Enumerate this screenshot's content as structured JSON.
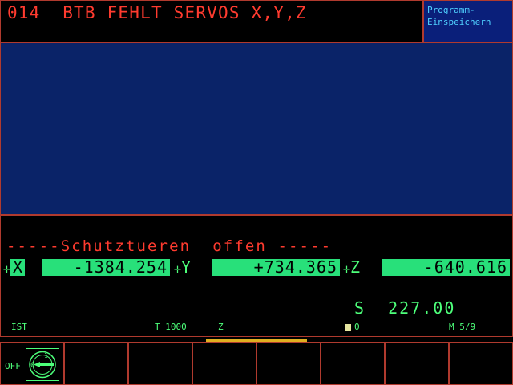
{
  "header": {
    "error_message": "014  BTB FEHLT SERVOS X,Y,Z",
    "mode_label": "Programm-\nEinspeichern"
  },
  "info": {
    "door_message": "-----Schutztueren  offen -----"
  },
  "axes": [
    {
      "letter": "X",
      "value": "-1384.254"
    },
    {
      "letter": "Y",
      "value": "+734.365"
    },
    {
      "letter": "Z",
      "value": "-640.616"
    }
  ],
  "spindle": {
    "label": "S",
    "value": "227.00"
  },
  "status": {
    "mode": "IST",
    "tool": "T 1000",
    "axis": "Z",
    "feed_icon": "feed-icon",
    "feed": "0",
    "m_function": "M 5/9"
  },
  "softkeys": {
    "key1_label": "OFF",
    "key1_icon": "override-dial-icon"
  },
  "colors": {
    "error_red": "#ff3b2f",
    "display_green": "#4dff7a",
    "value_bg": "#28e07a",
    "main_blue": "#0a2368",
    "mode_blue": "#0a1f7a",
    "mode_text": "#4fd0ff",
    "frame": "#b03a2e",
    "underline": "#e0b020"
  }
}
